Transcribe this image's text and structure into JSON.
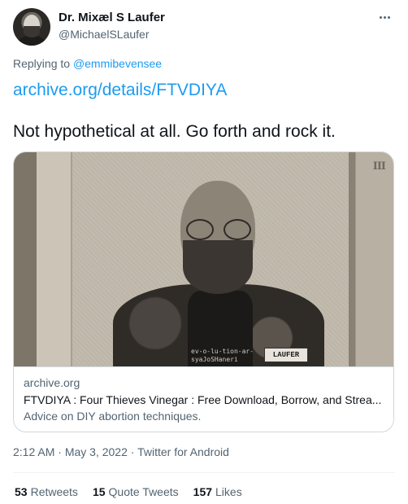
{
  "author": {
    "display_name": "Dr. Mixæl S Laufer",
    "handle": "@MichaelSLaufer"
  },
  "reply": {
    "prefix": "Replying to",
    "mention": "@emmibevensee"
  },
  "tweet": {
    "link": "archive.org/details/FTVDIYA",
    "text": "Not hypothetical at all. Go forth and rock it."
  },
  "card": {
    "domain": "archive.org",
    "title": "FTVDIYA : Four Thieves Vinegar : Free Download, Borrow, and Strea...",
    "description": "Advice on DIY abortion techniques.",
    "image_patch_text": "LAUFER",
    "image_shirt_text": "ev-o-lu-tion-ar-\nsyaJoSHaneri",
    "image_overlay_mark": "III"
  },
  "meta": {
    "time": "2:12 AM",
    "separator1": " · ",
    "date": "May 3, 2022",
    "separator2": " · ",
    "source": "Twitter for Android"
  },
  "stats": {
    "retweets_count": "53",
    "retweets_label": "Retweets",
    "quotes_count": "15",
    "quotes_label": "Quote Tweets",
    "likes_count": "157",
    "likes_label": "Likes"
  },
  "colors": {
    "link": "#1d9bf0",
    "secondary_text": "#536471",
    "primary_text": "#0f1419",
    "border": "#cfd9de"
  }
}
